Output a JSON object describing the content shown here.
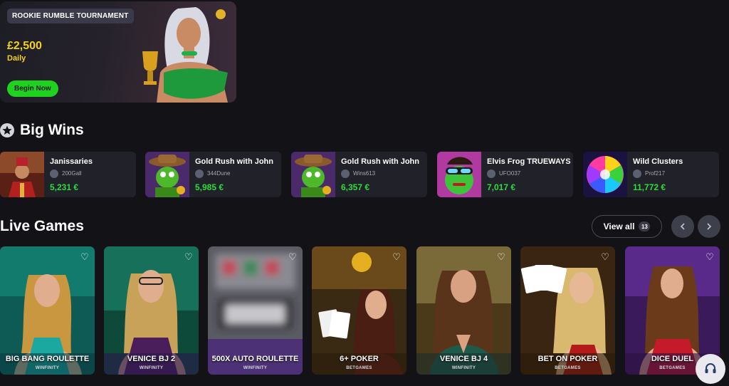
{
  "promo": {
    "tag": "ROOKIE RUMBLE TOURNAMENT",
    "amount": "£2,500",
    "period": "Daily",
    "cta": "Begin Now"
  },
  "big_wins": {
    "title": "Big Wins",
    "items": [
      {
        "game": "Janissaries",
        "user": "200Gall",
        "amount": "5,231 €"
      },
      {
        "game": "Gold Rush with John",
        "user": "344Dune",
        "amount": "5,985 €"
      },
      {
        "game": "Gold Rush with John",
        "user": "Wins613",
        "amount": "6,357 €"
      },
      {
        "game": "Elvis Frog TRUEWAYS",
        "user": "UFO037",
        "amount": "7,017 €"
      },
      {
        "game": "Wild Clusters",
        "user": "Prof217",
        "amount": "11,772 €"
      }
    ]
  },
  "live_games": {
    "title": "Live Games",
    "view_all_label": "View all",
    "view_all_count": "13",
    "items": [
      {
        "title": "BIG BANG ROULETTE",
        "provider": "WINFINITY"
      },
      {
        "title": "VENICE BJ 2",
        "provider": "WINFINITY"
      },
      {
        "title": "500X AUTO ROULETTE",
        "provider": "WINFINITY"
      },
      {
        "title": "6+ POKER",
        "provider": "BETGAMES"
      },
      {
        "title": "VENICE BJ 4",
        "provider": "WINFINITY"
      },
      {
        "title": "BET ON POKER",
        "provider": "BETGAMES"
      },
      {
        "title": "DICE DUEL",
        "provider": "BETGAMES"
      }
    ]
  },
  "icons": {
    "star": "star-icon",
    "heart": "heart-icon",
    "prev": "chevron-left-icon",
    "next": "chevron-right-icon",
    "support": "headset-icon"
  },
  "colors": {
    "background": "#121217",
    "card": "#212129",
    "accent_green": "#1fd21f",
    "win_amount": "#2bdc3a",
    "promo_gold": "#f2d21c"
  }
}
